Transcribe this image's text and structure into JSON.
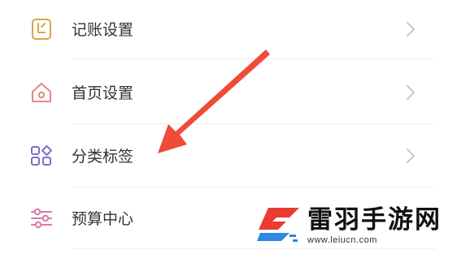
{
  "settings": {
    "items": [
      {
        "label": "记账设置",
        "icon": "ledger-icon"
      },
      {
        "label": "首页设置",
        "icon": "home-icon"
      },
      {
        "label": "分类标签",
        "icon": "category-grid-icon"
      },
      {
        "label": "预算中心",
        "icon": "sliders-icon"
      }
    ]
  },
  "annotation": {
    "color": "#f04b37"
  },
  "watermark": {
    "title": "雷羽手游网",
    "url": "www.leiucn.com",
    "colors": {
      "red": "#ea3b2e",
      "blue": "#2f86e6"
    }
  }
}
